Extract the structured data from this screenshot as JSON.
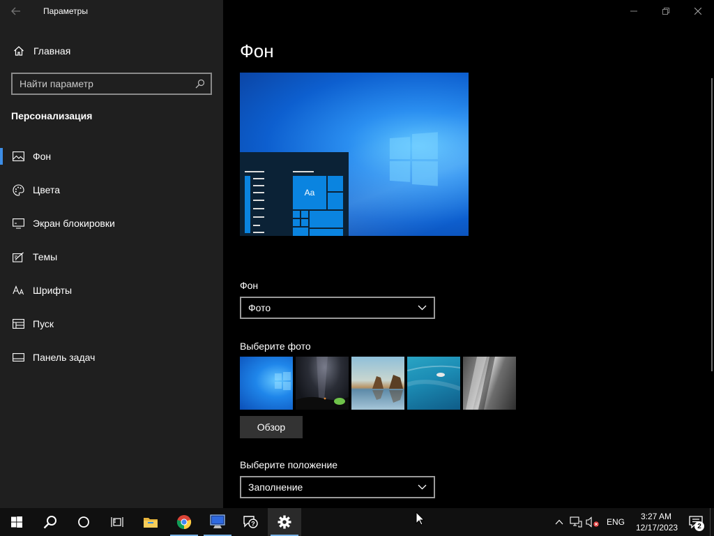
{
  "window": {
    "title": "Параметры"
  },
  "sidebar": {
    "home_label": "Главная",
    "search_placeholder": "Найти параметр",
    "section_title": "Персонализация",
    "items": [
      {
        "label": "Фон",
        "icon": "picture-icon",
        "active": true
      },
      {
        "label": "Цвета",
        "icon": "palette-icon",
        "active": false
      },
      {
        "label": "Экран блокировки",
        "icon": "monitor-icon",
        "active": false
      },
      {
        "label": "Темы",
        "icon": "brush-icon",
        "active": false
      },
      {
        "label": "Шрифты",
        "icon": "font-icon",
        "active": false
      },
      {
        "label": "Пуск",
        "icon": "start-icon",
        "active": false
      },
      {
        "label": "Панель задач",
        "icon": "taskbar-icon",
        "active": false
      }
    ]
  },
  "main": {
    "title": "Фон",
    "preview_tile_text": "Aa",
    "background_label": "Фон",
    "background_value": "Фото",
    "choose_photo_label": "Выберите фото",
    "browse_label": "Обзор",
    "position_label": "Выберите положение",
    "position_value": "Заполнение"
  },
  "taskbar": {
    "apps": [
      "start-icon",
      "search-icon",
      "cortana-icon",
      "task-view-icon",
      "file-explorer-icon",
      "chrome-icon",
      "computer-icon",
      "feedback-hub-icon",
      "settings-icon"
    ],
    "language": "ENG",
    "time": "3:27 AM",
    "date": "12/17/2023",
    "notification_count": "2"
  },
  "colors": {
    "accent": "#3d8ee6",
    "sidebar_bg": "#1f1f1f",
    "main_bg": "#000000",
    "taskbar_bg": "#101010"
  }
}
